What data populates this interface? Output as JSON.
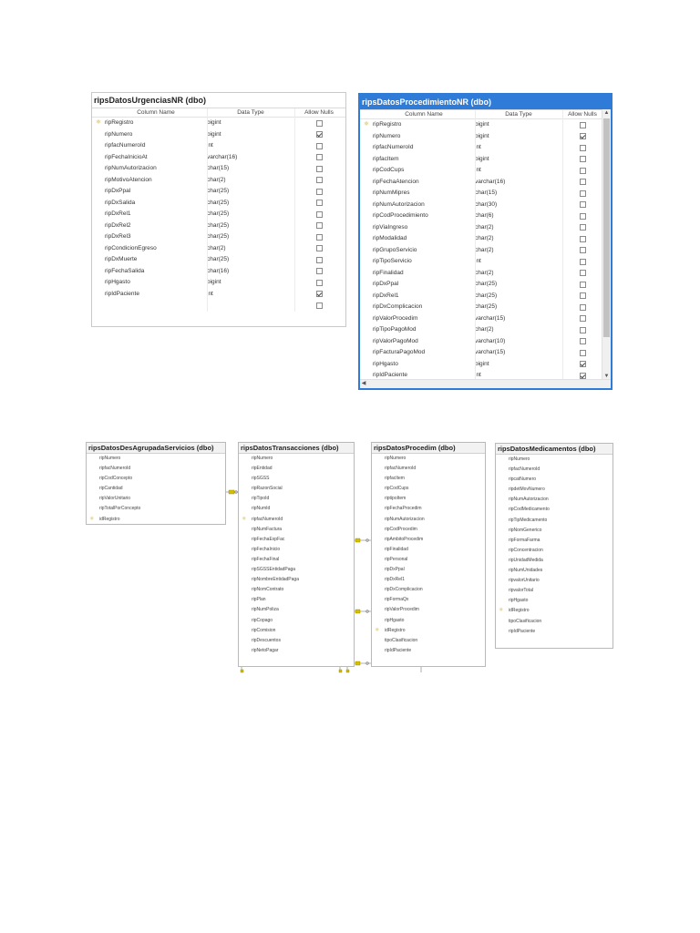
{
  "top": {
    "left_table": {
      "title": "ripsDatosUrgenciasNR (dbo)",
      "headers": [
        "Column Name",
        "Data Type",
        "Allow Nulls"
      ],
      "rows": [
        {
          "key": true,
          "name": "ripRegistro",
          "type": "bigint",
          "nulls": false
        },
        {
          "key": false,
          "name": "ripNumero",
          "type": "bigint",
          "nulls": true
        },
        {
          "key": false,
          "name": "ripfacNumeroId",
          "type": "int",
          "nulls": false
        },
        {
          "key": false,
          "name": "ripFechaInicioAt",
          "type": "varchar(16)",
          "nulls": false
        },
        {
          "key": false,
          "name": "ripNumAutorizacion",
          "type": "char(15)",
          "nulls": false
        },
        {
          "key": false,
          "name": "ripMotivoAtencion",
          "type": "char(2)",
          "nulls": false
        },
        {
          "key": false,
          "name": "ripDxPpal",
          "type": "char(25)",
          "nulls": false
        },
        {
          "key": false,
          "name": "ripDxSalida",
          "type": "char(25)",
          "nulls": false
        },
        {
          "key": false,
          "name": "ripDxRel1",
          "type": "char(25)",
          "nulls": false
        },
        {
          "key": false,
          "name": "ripDxRel2",
          "type": "char(25)",
          "nulls": false
        },
        {
          "key": false,
          "name": "ripDxRel3",
          "type": "char(25)",
          "nulls": false
        },
        {
          "key": false,
          "name": "ripCondicionEgreso",
          "type": "char(2)",
          "nulls": false
        },
        {
          "key": false,
          "name": "ripDxMuerte",
          "type": "char(25)",
          "nulls": false
        },
        {
          "key": false,
          "name": "ripFechaSalida",
          "type": "char(16)",
          "nulls": false
        },
        {
          "key": false,
          "name": "ripHgasto",
          "type": "bigint",
          "nulls": false
        },
        {
          "key": false,
          "name": "ripIdPaciente",
          "type": "int",
          "nulls": true
        },
        {
          "key": false,
          "name": "",
          "type": "",
          "nulls": false
        }
      ]
    },
    "right_table": {
      "title": "ripsDatosProcedimientoNR (dbo)",
      "headers": [
        "Column Name",
        "Data Type",
        "Allow Nulls"
      ],
      "rows": [
        {
          "key": true,
          "name": "ripRegistro",
          "type": "bigint",
          "nulls": false
        },
        {
          "key": false,
          "name": "ripNumero",
          "type": "bigint",
          "nulls": true
        },
        {
          "key": false,
          "name": "ripfacNumeroId",
          "type": "int",
          "nulls": false
        },
        {
          "key": false,
          "name": "ripfacItem",
          "type": "bigint",
          "nulls": false
        },
        {
          "key": false,
          "name": "ripCodCups",
          "type": "int",
          "nulls": false
        },
        {
          "key": false,
          "name": "ripFechaAtencion",
          "type": "varchar(16)",
          "nulls": false
        },
        {
          "key": false,
          "name": "ripNumMipres",
          "type": "char(15)",
          "nulls": false
        },
        {
          "key": false,
          "name": "ripNumAutorizacion",
          "type": "char(30)",
          "nulls": false
        },
        {
          "key": false,
          "name": "ripCodProcedimiento",
          "type": "char(6)",
          "nulls": false
        },
        {
          "key": false,
          "name": "ripViaIngreso",
          "type": "char(2)",
          "nulls": false
        },
        {
          "key": false,
          "name": "ripModalidad",
          "type": "char(2)",
          "nulls": false
        },
        {
          "key": false,
          "name": "ripGrupoServicio",
          "type": "char(2)",
          "nulls": false
        },
        {
          "key": false,
          "name": "ripTipoServicio",
          "type": "int",
          "nulls": false
        },
        {
          "key": false,
          "name": "ripFinalidad",
          "type": "char(2)",
          "nulls": false
        },
        {
          "key": false,
          "name": "ripDxPpal",
          "type": "char(25)",
          "nulls": false
        },
        {
          "key": false,
          "name": "ripDxRel1",
          "type": "char(25)",
          "nulls": false
        },
        {
          "key": false,
          "name": "ripDxComplicacion",
          "type": "char(25)",
          "nulls": false
        },
        {
          "key": false,
          "name": "ripValorProcedim",
          "type": "varchar(15)",
          "nulls": false
        },
        {
          "key": false,
          "name": "ripTipoPagoMod",
          "type": "char(2)",
          "nulls": false
        },
        {
          "key": false,
          "name": "ripValorPagoMod",
          "type": "varchar(10)",
          "nulls": false
        },
        {
          "key": false,
          "name": "ripFacturaPagoMod",
          "type": "varchar(15)",
          "nulls": false
        },
        {
          "key": false,
          "name": "ripHgasto",
          "type": "bigint",
          "nulls": true
        },
        {
          "key": false,
          "name": "ripIdPaciente",
          "type": "int",
          "nulls": true
        }
      ]
    }
  },
  "bottom": {
    "agrupada": {
      "title": "ripsDatosDesAgrupadaServicios (dbo)",
      "rows": [
        {
          "key": false,
          "name": "ripNumero"
        },
        {
          "key": false,
          "name": "ripfacNumeroId"
        },
        {
          "key": false,
          "name": "ripCodConcepto"
        },
        {
          "key": false,
          "name": "ripCantidad"
        },
        {
          "key": false,
          "name": "ripValorUnitario"
        },
        {
          "key": false,
          "name": "ripTotalPorConcepto"
        },
        {
          "key": true,
          "name": "idRegistro"
        }
      ]
    },
    "transacciones": {
      "title": "ripsDatosTransacciones (dbo)",
      "rows": [
        {
          "key": false,
          "name": "ripNumero"
        },
        {
          "key": false,
          "name": "ripEntidad"
        },
        {
          "key": false,
          "name": "ripSGSS"
        },
        {
          "key": false,
          "name": "ripRazonSocial"
        },
        {
          "key": false,
          "name": "ripTipoId"
        },
        {
          "key": false,
          "name": "ripNumId"
        },
        {
          "key": true,
          "name": "ripfacNumeroId"
        },
        {
          "key": false,
          "name": "ripNumFactura"
        },
        {
          "key": false,
          "name": "ripFechaExpFac"
        },
        {
          "key": false,
          "name": "ripFechaInicio"
        },
        {
          "key": false,
          "name": "ripFechaFinal"
        },
        {
          "key": false,
          "name": "ripSGSSEntidadPaga"
        },
        {
          "key": false,
          "name": "ripNombreEntidadPaga"
        },
        {
          "key": false,
          "name": "ripNomContrato"
        },
        {
          "key": false,
          "name": "ripPlan"
        },
        {
          "key": false,
          "name": "ripNumPoliza"
        },
        {
          "key": false,
          "name": "ripCopago"
        },
        {
          "key": false,
          "name": "ripComision"
        },
        {
          "key": false,
          "name": "ripDescuentos"
        },
        {
          "key": false,
          "name": "ripNetoPagar"
        }
      ]
    },
    "procedim": {
      "title": "ripsDatosProcedim (dbo)",
      "rows": [
        {
          "key": false,
          "name": "ripNumero"
        },
        {
          "key": false,
          "name": "ripfacNumeroId"
        },
        {
          "key": false,
          "name": "ripfacItem"
        },
        {
          "key": false,
          "name": "ripCodCups"
        },
        {
          "key": false,
          "name": "riptipoItem"
        },
        {
          "key": false,
          "name": "ripFechaProcedim"
        },
        {
          "key": false,
          "name": "ripNumAutorizacion"
        },
        {
          "key": false,
          "name": "ripCodProcedim"
        },
        {
          "key": false,
          "name": "ripAmbitoProcedim"
        },
        {
          "key": false,
          "name": "ripFinalidad"
        },
        {
          "key": false,
          "name": "ripPersonal"
        },
        {
          "key": false,
          "name": "ripDxPpal"
        },
        {
          "key": false,
          "name": "ripDxRel1"
        },
        {
          "key": false,
          "name": "ripDxComplicacion"
        },
        {
          "key": false,
          "name": "ripFormaQx"
        },
        {
          "key": false,
          "name": "ripValorProcedim"
        },
        {
          "key": false,
          "name": "ripHgasto"
        },
        {
          "key": true,
          "name": "idRegistro"
        },
        {
          "key": false,
          "name": "tipoClasificacion"
        },
        {
          "key": false,
          "name": "ripIdPaciente"
        }
      ]
    },
    "medicamentos": {
      "title": "ripsDatosMedicamentos (dbo)",
      "rows": [
        {
          "key": false,
          "name": "ripNumero"
        },
        {
          "key": false,
          "name": "ripfacNumeroId"
        },
        {
          "key": false,
          "name": "ripcatNumero"
        },
        {
          "key": false,
          "name": "ripdetMovNumero"
        },
        {
          "key": false,
          "name": "ripNumAutorizacion"
        },
        {
          "key": false,
          "name": "ripCodMedicamento"
        },
        {
          "key": false,
          "name": "ripTipMedicamento"
        },
        {
          "key": false,
          "name": "ripNomGenerico"
        },
        {
          "key": false,
          "name": "ripFormaFarma"
        },
        {
          "key": false,
          "name": "ripConcentracion"
        },
        {
          "key": false,
          "name": "ripUnidadMedida"
        },
        {
          "key": false,
          "name": "ripNumUnidades"
        },
        {
          "key": false,
          "name": "ripvalorUnitario"
        },
        {
          "key": false,
          "name": "ripvalorTotal"
        },
        {
          "key": false,
          "name": "ripHgasto"
        },
        {
          "key": true,
          "name": "idRegistro"
        },
        {
          "key": false,
          "name": "tipoClasificacion"
        },
        {
          "key": false,
          "name": "ripIdPaciente"
        }
      ]
    }
  },
  "icons": {
    "primary_key": "key-icon",
    "relationship": "relationship-connector-icon",
    "checkbox": "checkbox-icon"
  },
  "colors": {
    "selected_accent": "#2f7bd8",
    "key_gold": "#c9a227",
    "connector": "#d4c000"
  }
}
